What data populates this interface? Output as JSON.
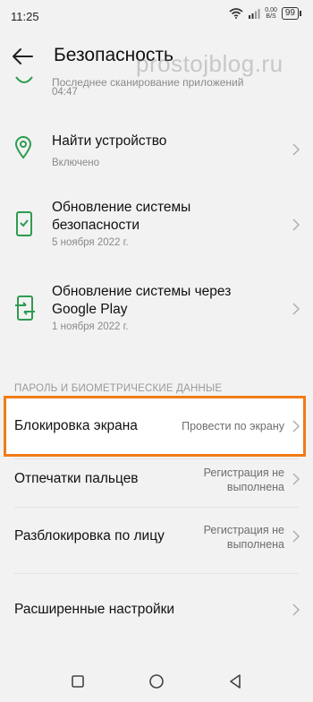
{
  "status": {
    "time": "11:25",
    "net_speed_top": "0,00",
    "net_speed_bottom": "B/S",
    "battery": "99"
  },
  "header": {
    "title": "Безопасность",
    "watermark": "prostojblog.ru"
  },
  "items": [
    {
      "title": "Последнее сканирование приложений",
      "sub": "04:47",
      "icon": "shield-check-icon"
    },
    {
      "title": "Найти устройство",
      "sub": "Включено",
      "icon": "location-pin-icon"
    },
    {
      "title": "Обновление системы безопасности",
      "sub": "5 ноября 2022 г.",
      "icon": "phone-check-icon"
    },
    {
      "title": "Обновление системы через Google Play",
      "sub": "1 ноября 2022 г.",
      "icon": "phone-sync-icon"
    }
  ],
  "section": {
    "label": "ПАРОЛЬ И БИОМЕТРИЧЕСКИЕ ДАННЫЕ"
  },
  "rows": [
    {
      "title": "Блокировка экрана",
      "value": "Провести по экрану"
    },
    {
      "title": "Отпечатки пальцев",
      "value_line1": "Регистрация не",
      "value_line2": "выполнена"
    },
    {
      "title": "Разблокировка по лицу",
      "value_line1": "Регистрация не",
      "value_line2": "выполнена"
    },
    {
      "title": "Расширенные настройки"
    }
  ],
  "colors": {
    "accent": "#2e9b4f",
    "highlight": "#f07b16"
  }
}
